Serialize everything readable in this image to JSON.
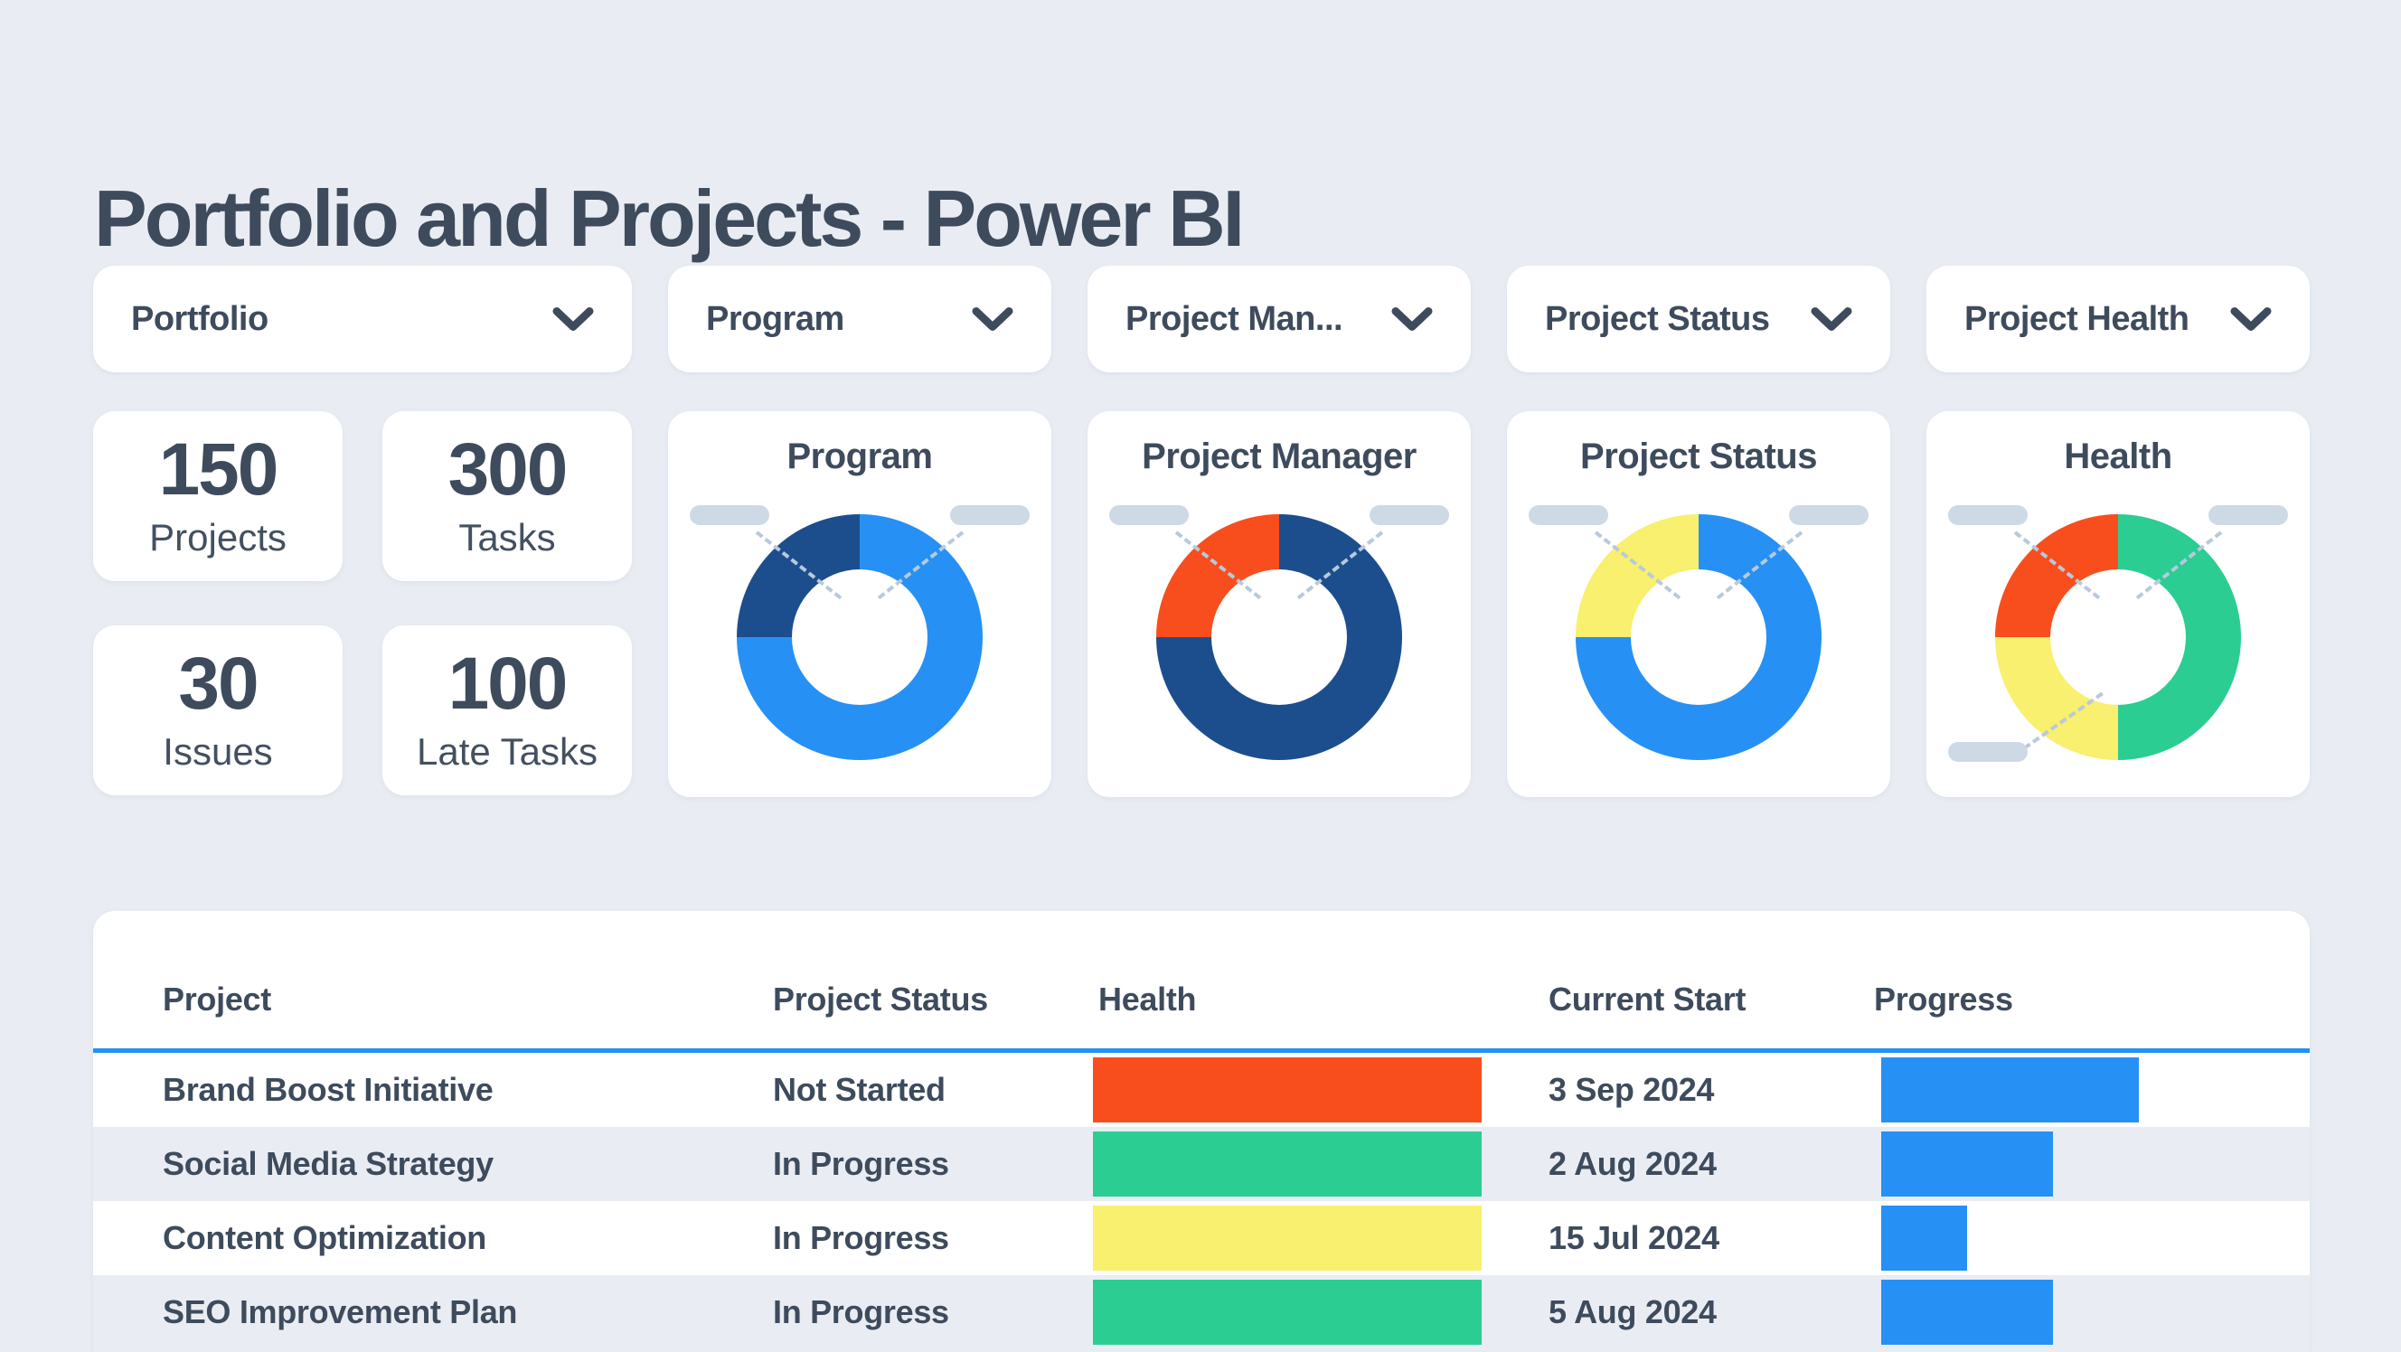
{
  "page": {
    "title": "Portfolio and Projects - Power BI",
    "background": "#e9edf3"
  },
  "colors": {
    "text_dark": "#3e4b5d",
    "card_white": "#ffffff",
    "accent_blue": "#2690f5",
    "navy_blue": "#1c4e8e",
    "red_orange": "#f84e1d",
    "green": "#2bcd92",
    "yellow": "#f8f06e",
    "callout_pill": "#ced9e6",
    "callout_line": "#b8c9dc",
    "row_alternate": "#e9edf3"
  },
  "filters": [
    {
      "label": "Portfolio"
    },
    {
      "label": "Program"
    },
    {
      "label": "Project Man..."
    },
    {
      "label": "Project Status"
    },
    {
      "label": "Project Health"
    }
  ],
  "kpis": [
    {
      "value": "150",
      "label": "Projects"
    },
    {
      "value": "300",
      "label": "Tasks"
    },
    {
      "value": "30",
      "label": "Issues"
    },
    {
      "value": "100",
      "label": "Late Tasks"
    }
  ],
  "chart_data": [
    {
      "type": "pie",
      "subtype": "donut",
      "title": "Program",
      "legend": "hidden",
      "callouts": [
        "top-left",
        "top-right"
      ],
      "slices": [
        {
          "label": "segment-1",
          "value": 75,
          "color": "#2690f5"
        },
        {
          "label": "segment-2",
          "value": 25,
          "color": "#1c4e8e"
        }
      ]
    },
    {
      "type": "pie",
      "subtype": "donut",
      "title": "Project Manager",
      "legend": "hidden",
      "callouts": [
        "top-left",
        "top-right"
      ],
      "slices": [
        {
          "label": "segment-1",
          "value": 75,
          "color": "#1c4e8e"
        },
        {
          "label": "segment-2",
          "value": 25,
          "color": "#f84e1d"
        }
      ]
    },
    {
      "type": "pie",
      "subtype": "donut",
      "title": "Project Status",
      "legend": "hidden",
      "callouts": [
        "top-left",
        "top-right"
      ],
      "slices": [
        {
          "label": "segment-1",
          "value": 75,
          "color": "#2690f5"
        },
        {
          "label": "segment-2",
          "value": 25,
          "color": "#f8f06e"
        }
      ]
    },
    {
      "type": "pie",
      "subtype": "donut",
      "title": "Health",
      "legend": "hidden",
      "callouts": [
        "top-left",
        "top-right",
        "bottom-left"
      ],
      "slices": [
        {
          "label": "segment-1",
          "value": 50,
          "color": "#2bcd92"
        },
        {
          "label": "segment-2",
          "value": 25,
          "color": "#f8f06e"
        },
        {
          "label": "segment-3",
          "value": 25,
          "color": "#f84e1d"
        }
      ]
    }
  ],
  "table": {
    "columns": [
      "Project",
      "Project Status",
      "Health",
      "Current Start",
      "Progress"
    ],
    "rows": [
      {
        "project": "Brand Boost Initiative",
        "status": "Not Started",
        "health_color": "#f84e1d",
        "current_start": "3 Sep 2024",
        "progress_pct": 75
      },
      {
        "project": "Social Media Strategy",
        "status": "In Progress",
        "health_color": "#2bcd92",
        "current_start": "2 Aug 2024",
        "progress_pct": 50
      },
      {
        "project": "Content Optimization",
        "status": "In Progress",
        "health_color": "#f8f06e",
        "current_start": "15 Jul 2024",
        "progress_pct": 25
      },
      {
        "project": "SEO Improvement Plan",
        "status": "In Progress",
        "health_color": "#2bcd92",
        "current_start": "5 Aug 2024",
        "progress_pct": 50
      }
    ]
  }
}
